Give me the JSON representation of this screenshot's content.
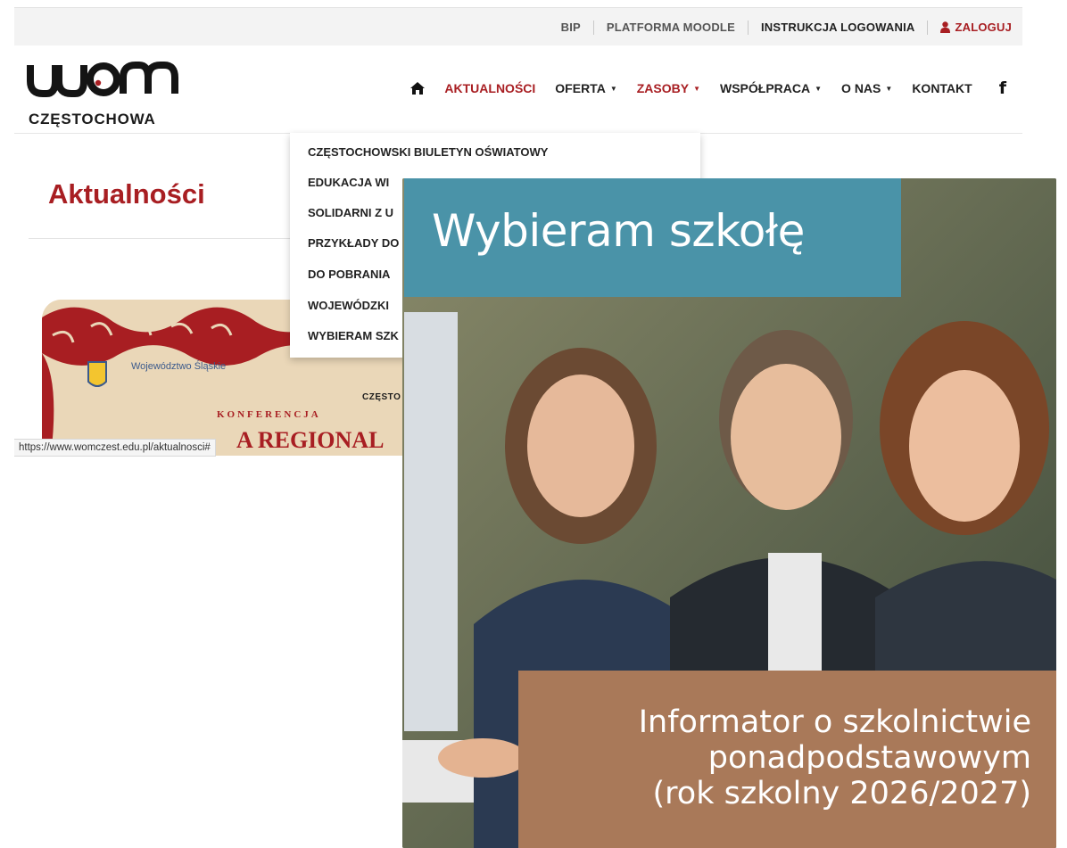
{
  "topbar": {
    "links": [
      "BIP",
      "PLATFORMA MOODLE",
      "INSTRUKCJA LOGOWANIA"
    ],
    "login_label": "ZALOGUJ"
  },
  "logo": {
    "text": "CZĘSTOCHOWA"
  },
  "nav": {
    "items": [
      {
        "label": "AKTUALNOŚCI",
        "active": true
      },
      {
        "label": "OFERTA"
      },
      {
        "label": "ZASOBY",
        "active": true
      },
      {
        "label": "WSPÓŁPRACA"
      },
      {
        "label": "O NAS"
      },
      {
        "label": "KONTAKT"
      }
    ],
    "icons": [
      "home-icon",
      "facebook-icon"
    ]
  },
  "dropdown": {
    "items": [
      "CZĘSTOCHOWSKI BIULETYN OŚWIATOWY",
      "EDUKACJA WI",
      "SOLIDARNI Z U",
      "PRZYKŁADY DO",
      "DO POBRANIA",
      "WOJEWÓDZKI",
      "WYBIERAM SZK"
    ]
  },
  "page": {
    "title": "Aktualności"
  },
  "banner": {
    "region": "Województwo Śląskie",
    "konferencja": "KONFERENCJA",
    "partial_logo": "CZĘSTO",
    "heading_partial": "A REGIONAL"
  },
  "statusbar": {
    "url": "https://www.womczest.edu.pl/aktualnosci#"
  },
  "popup": {
    "title": "Wybieram szkołę",
    "bottom_lines": [
      "Informator o szkolnictwie",
      "ponadpodstawowym",
      "(rok szkolny 2026/2027)"
    ]
  },
  "colors": {
    "brand_red": "#a81e22",
    "teal": "#4a93a8",
    "brown": "#a97959"
  }
}
